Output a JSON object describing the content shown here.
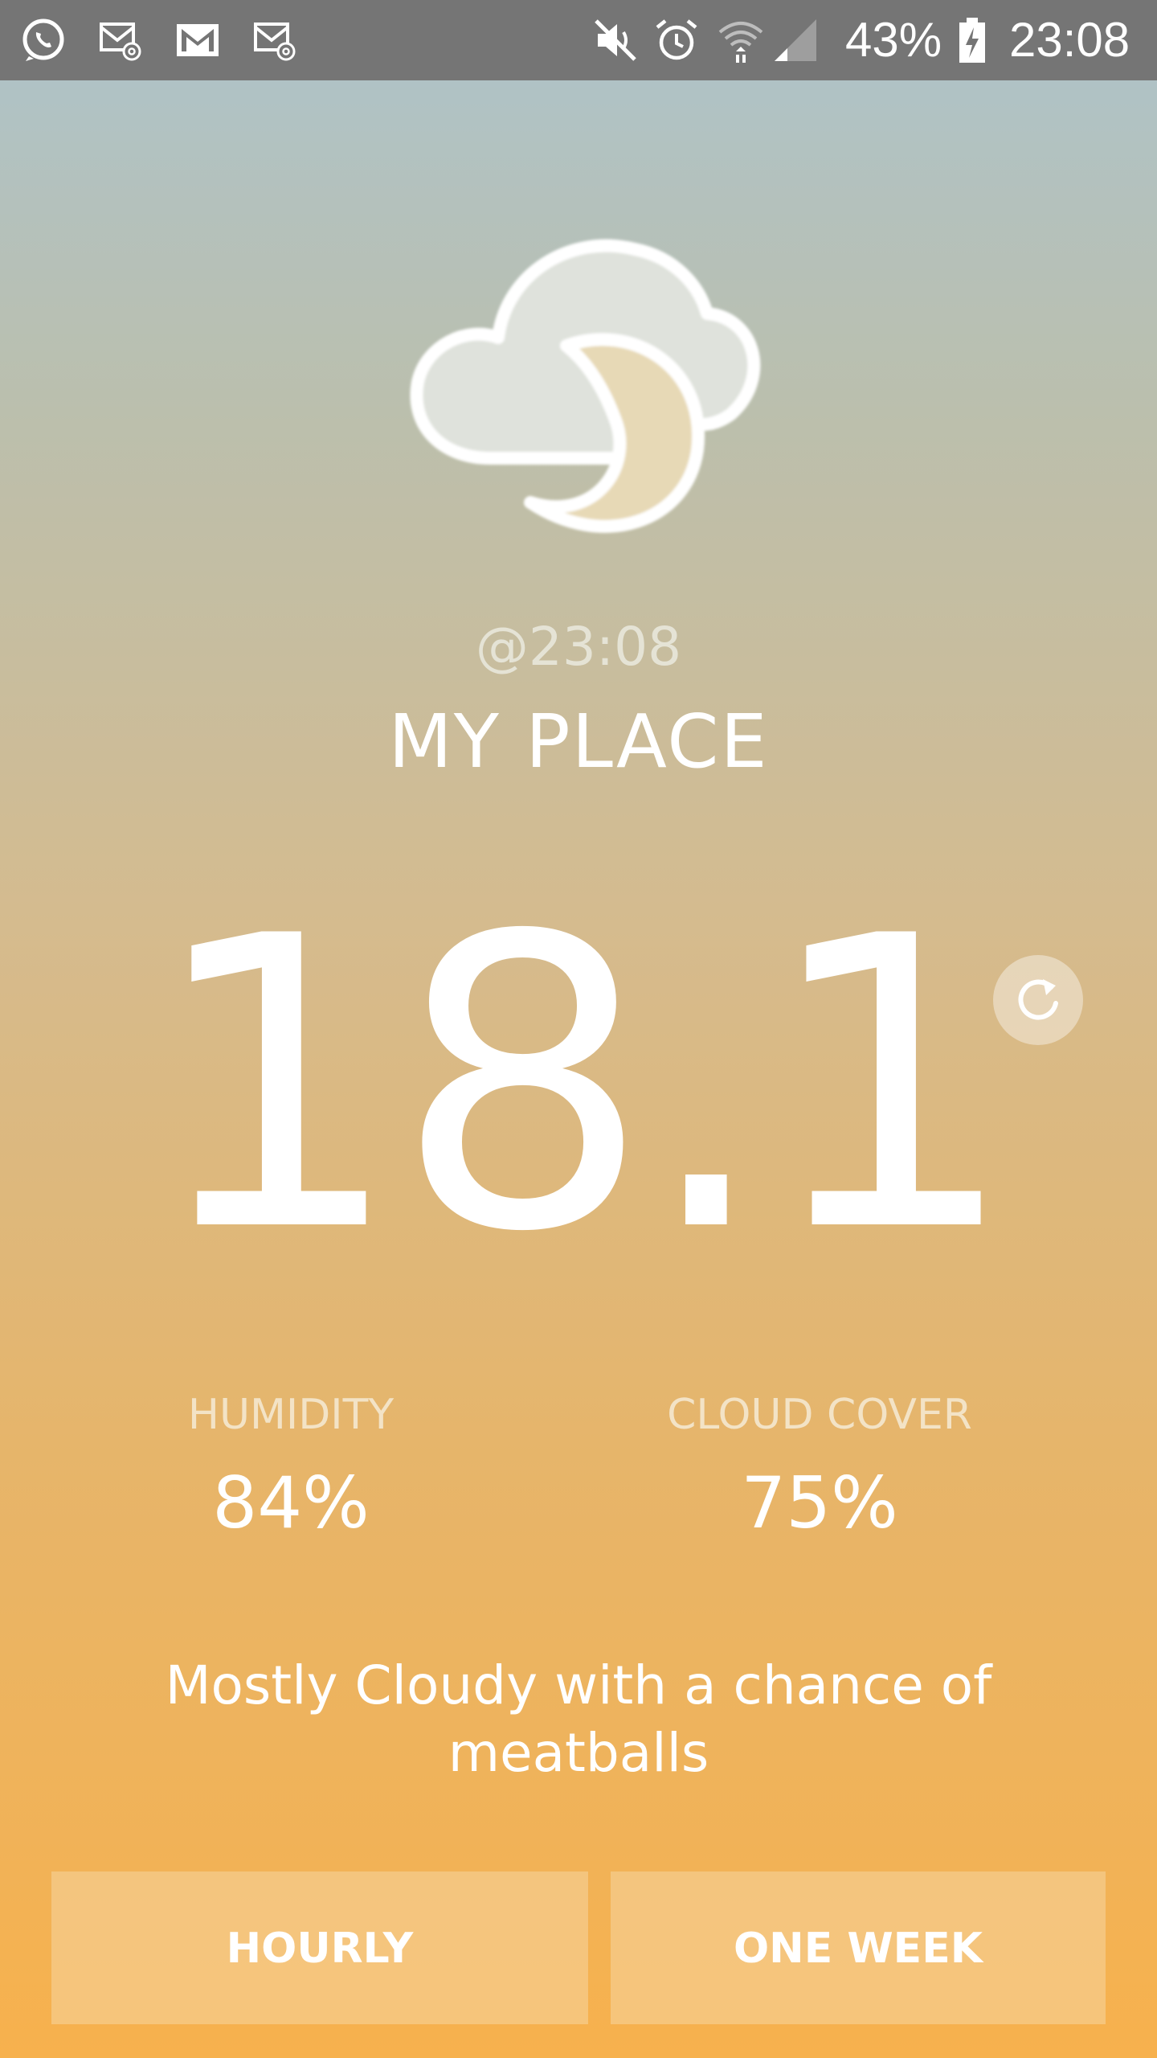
{
  "status_bar": {
    "battery_text": "43%",
    "clock": "23:08",
    "icons": [
      "whatsapp-icon",
      "email-notification-icon",
      "gmail-icon",
      "email-notification-icon",
      "mute-icon",
      "alarm-icon",
      "wifi-icon",
      "signal-icon",
      "battery-charging-icon"
    ]
  },
  "weather": {
    "icon": "cloudy-night-icon",
    "updated_time": "@23:08",
    "location": "MY PLACE",
    "temperature": "18.1",
    "humidity_label": "HUMIDITY",
    "humidity_value": "84%",
    "cloud_label": "CLOUD COVER",
    "cloud_value": "75%",
    "summary": "Mostly Cloudy with a chance of meatballs"
  },
  "actions": {
    "hourly_label": "HOURLY",
    "week_label": "ONE WEEK"
  },
  "colors": {
    "status_bar": "#757575",
    "gradient_top": "#adc3cb",
    "gradient_bottom": "#f7b14d",
    "text": "#ffffff"
  }
}
